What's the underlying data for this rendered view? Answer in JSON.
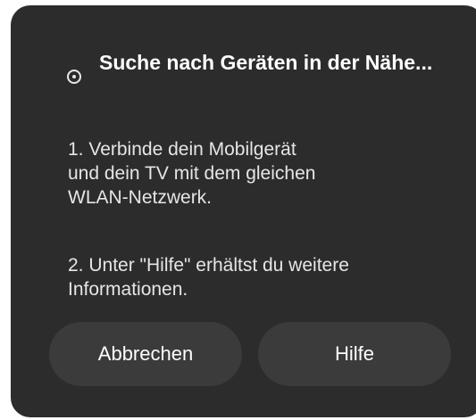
{
  "dialog": {
    "title": "Suche nach Geräten in der Nähe...",
    "icon": "radar-icon",
    "step1": "1. Verbinde dein Mobilgerät\nund dein TV mit dem gleichen\nWLAN-Netzwerk.",
    "step2": "2. Unter \"Hilfe\" erhältst du weitere\nInformationen.",
    "buttons": {
      "cancel_label": "Abbrechen",
      "help_label": "Hilfe"
    }
  },
  "colors": {
    "dialog_bg": "#2c2c2c",
    "button_bg": "#3b3b3b",
    "text": "#ffffff"
  }
}
